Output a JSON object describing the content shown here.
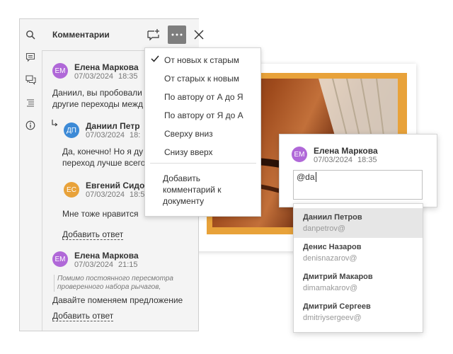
{
  "panel": {
    "title": "Комментарии"
  },
  "comments": [
    {
      "initials": "ЕМ",
      "author": "Елена Маркова",
      "date": "07/03/2024",
      "time": "18:35",
      "color": "#b068d8",
      "text_line1": "Даниил, вы пробовали",
      "text_line2": "другие переходы межд"
    },
    {
      "initials": "ДП",
      "author": "Даниил Петр",
      "date": "07/03/2024",
      "time": "18:",
      "color": "#3d8ad6",
      "text_line1": "Да, конечно! Но я ду",
      "text_line2": "переход лучше всего"
    },
    {
      "initials": "ЕС",
      "author": "Евгений Сидо",
      "date": "07/03/2024",
      "time": "18:5",
      "color": "#e8a23a",
      "text_line1": "Мне тоже нравится"
    },
    {
      "initials": "ЕМ",
      "author": "Елена Маркова",
      "date": "07/03/2024",
      "time": "21:15",
      "color": "#b068d8",
      "quote_line1": "Помимо постоянного пересмотра",
      "quote_line2": "проверенного набора рычагов,",
      "text_line1": "Давайте поменяем предложение"
    }
  ],
  "add_reply_label": "Добавить ответ",
  "sort_menu": {
    "items": [
      "От новых к старым",
      "От старых к новым",
      "По автору от А до Я",
      "По автору от Я до А",
      "Сверху вниз",
      "Снизу вверх"
    ],
    "selected": "От новых к старым",
    "add_doc_comment": [
      "Добавить",
      "комментарий к",
      "документу"
    ]
  },
  "popup": {
    "initials": "ЕМ",
    "author": "Елена Маркова",
    "date": "07/03/2024",
    "time": "18:35",
    "input_value": "@da"
  },
  "mentions": [
    {
      "name": "Даниил Петров",
      "email": "danpetrov@"
    },
    {
      "name": "Денис Назаров",
      "email": "denisnazarov@"
    },
    {
      "name": "Дмитрий Макаров",
      "email": "dimamakarov@"
    },
    {
      "name": "Дмитрий Сергеев",
      "email": "dmitriysergeev@"
    }
  ],
  "colors": {
    "accent_purple": "#b068d8",
    "accent_blue": "#3d8ad6",
    "accent_orange": "#e8a23a",
    "menu_button": "#7e7e7e"
  }
}
